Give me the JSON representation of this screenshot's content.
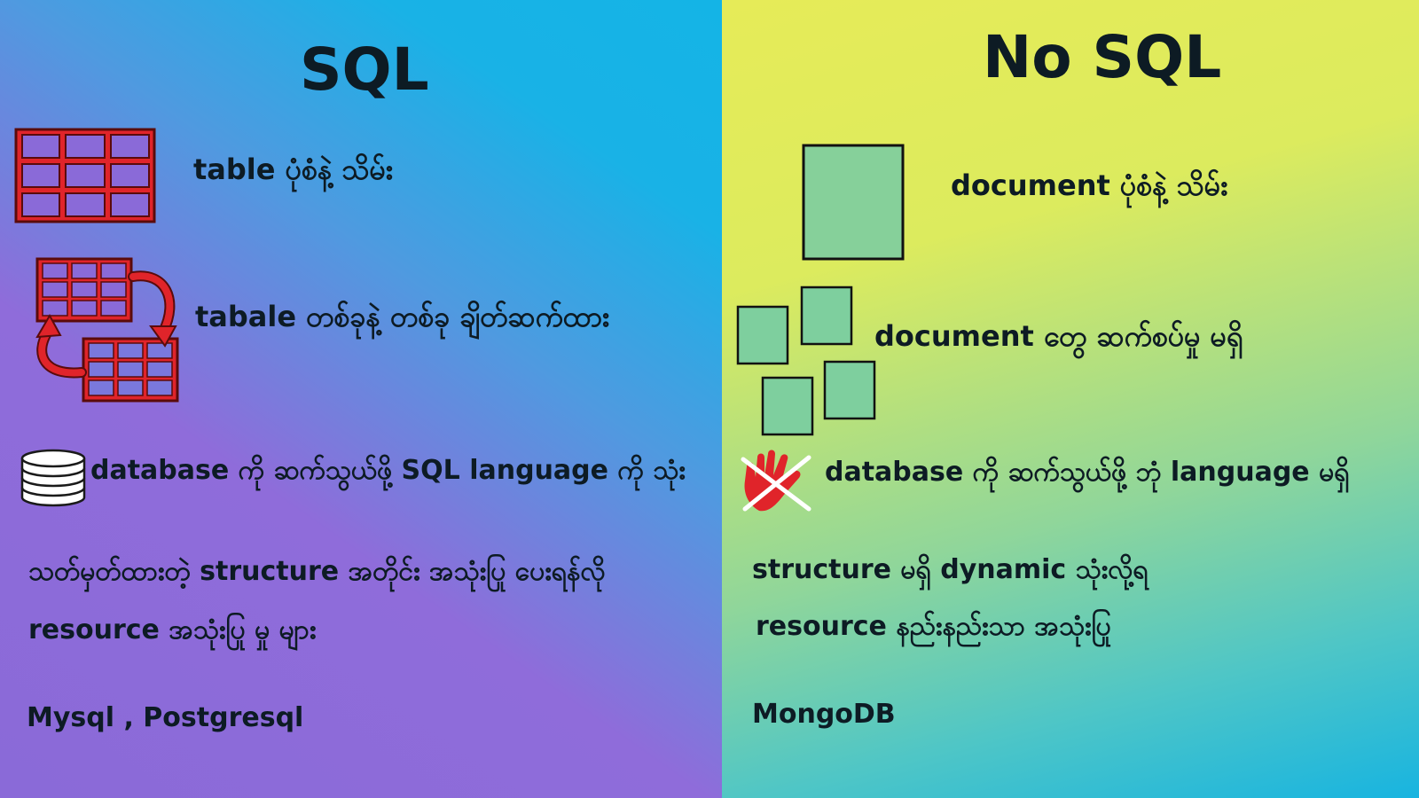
{
  "sql": {
    "title": "SQL",
    "rows": [
      "table ပုံစံနဲ့ သိမ်း",
      "tabale တစ်ခုနဲ့ တစ်ခု ချိတ်ဆက်ထား",
      "database ကို ဆက်သွယ်ဖို့ SQL language ကို သုံး",
      "သတ်မှတ်ထားတဲ့ structure အတိုင်း အသုံးပြု ပေးရန်လို",
      "resource အသုံးပြု မှု များ",
      "Mysql , Postgresql"
    ],
    "icons": [
      "table-grid-icon",
      "linked-tables-icon",
      "database-icon"
    ]
  },
  "nosql": {
    "title": "No SQL",
    "rows": [
      "document ပုံစံနဲ့ သိမ်း",
      "document တွေ ဆက်စပ်မှု မရှိ",
      "database ကို ဆက်သွယ်ဖို့ ဘုံ language မရှိ",
      "structure မရှိ dynamic သုံးလို့ရ",
      "resource နည်းနည်းသာ အသုံးပြု",
      "MongoDB"
    ],
    "icons": [
      "document-icon",
      "scattered-documents-icon",
      "no-hand-icon"
    ]
  },
  "colors": {
    "sql_bg_start": "#8a6ad8",
    "sql_bg_end": "#14b4e6",
    "nosql_bg_start": "#e6eb58",
    "nosql_bg_end": "#18b4e0",
    "table_fill": "#e0242a",
    "table_stroke": "#5a0b0b",
    "document_fill": "#86d09a",
    "text": "#0d1b24"
  }
}
